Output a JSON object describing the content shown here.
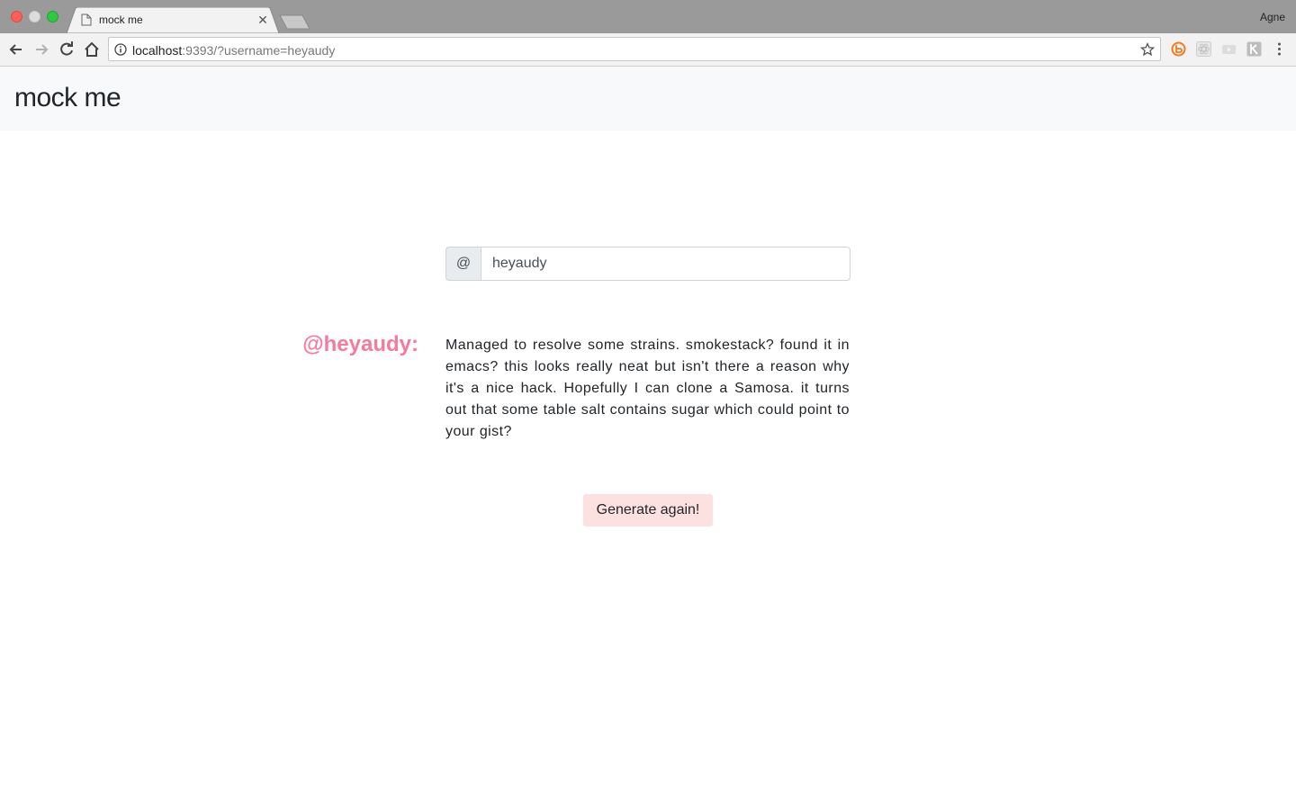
{
  "browser": {
    "tab_title": "mock me",
    "profile_name": "Agne",
    "url_host": "localhost",
    "url_rest": ":9393/?username=heyaudy",
    "nav_icons": [
      "back-icon",
      "forward-icon",
      "reload-icon",
      "home-icon"
    ],
    "extension_icons": [
      "extension-orange-icon",
      "extension-react-icon",
      "extension-cast-icon",
      "extension-k-icon",
      "menu-icon"
    ]
  },
  "header": {
    "brand": "mock me"
  },
  "form": {
    "prefix": "@",
    "username_value": "heyaudy"
  },
  "result": {
    "handle": "@heyaudy:",
    "text": "Managed to resolve some strains. smokestack? found it in emacs? this looks really neat but isn't there a reason why it's a nice hack. Hopefully I can clone a Samosa. it turns out that some table salt contains sugar which could point to your gist?"
  },
  "actions": {
    "generate_label": "Generate again!"
  },
  "colors": {
    "handle": "#f77a9e",
    "button_bg": "#fde1e1",
    "header_bg": "#f8f9fa"
  }
}
